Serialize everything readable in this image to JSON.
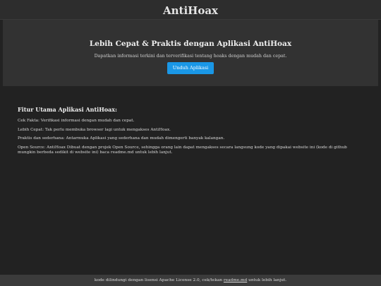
{
  "header": {
    "title": "AntiHoax"
  },
  "hero": {
    "heading": "Lebih Cepat & Praktis dengan Aplikasi AntiHoax",
    "description": "Dapatkan informasi terkini dan terverifikasi tentang hoaks dengan mudah dan cepat.",
    "button_label": "Unduh Aplikasi"
  },
  "features": {
    "heading": "Fitur Utama Aplikasi AntiHoax:",
    "items": [
      "Cek Fakta: Verifikasi informasi dengan mudah dan cepat.",
      "Lebih Cepat: Tak perlu membuka browser lagi untuk mengakses AntiHoax.",
      "Praktis dan sederhana: Antarmuka Aplikasi yang sederhana dan mudah dimengerti banyak kalangan.",
      "Open Source: AntiHoax Dibuat dengan projek Open Source, sehingga orang lain dapat mengakses secara langsung kode yang dipakai website ini (kode di github mungkin berbeda sedikit di website ini) baca readme.md untuk lebih lanjut."
    ]
  },
  "footer": {
    "text_before": "kode dilindungi dengan lisensi Apache License 2.0, cek/tekan ",
    "link_text": "readme.md",
    "text_after": " untuk lebih lanjut."
  },
  "colors": {
    "background": "#222222",
    "hero_background": "#323232",
    "button": "#1a97e6"
  }
}
